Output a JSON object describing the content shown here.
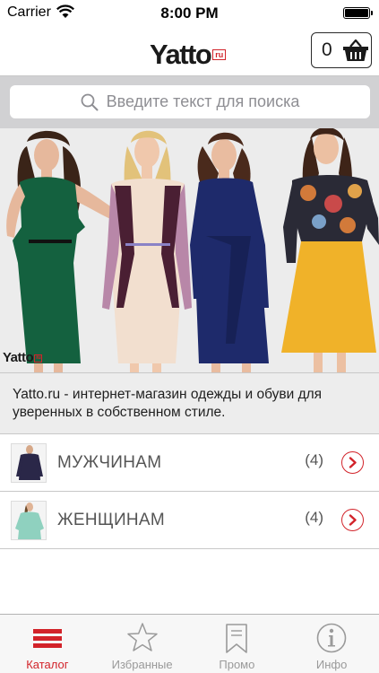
{
  "status_bar": {
    "carrier": "Carrier",
    "time": "8:00 PM"
  },
  "nav": {
    "logo_text": "Yatto",
    "logo_suffix": "ru",
    "cart_count": "0"
  },
  "search": {
    "placeholder": "Введите текст для поиска"
  },
  "banner": {
    "logo_text": "Yatto",
    "logo_suffix": "ru"
  },
  "description": "Yatto.ru - интернет-магазин одежды и обуви для уверенных в собственном стиле.",
  "categories": [
    {
      "label": "МУЖЧИНАМ",
      "count": "(4)"
    },
    {
      "label": "ЖЕНЩИНАМ",
      "count": "(4)"
    }
  ],
  "tabs": [
    {
      "label": "Каталог",
      "icon": "menu-icon",
      "active": true
    },
    {
      "label": "Избранные",
      "icon": "star-icon",
      "active": false
    },
    {
      "label": "Промо",
      "icon": "bookmark-icon",
      "active": false
    },
    {
      "label": "Инфо",
      "icon": "info-icon",
      "active": false
    }
  ],
  "colors": {
    "accent": "#d2232a",
    "search_background": "#d1d1d3",
    "tab_inactive": "#9a9a9a"
  }
}
